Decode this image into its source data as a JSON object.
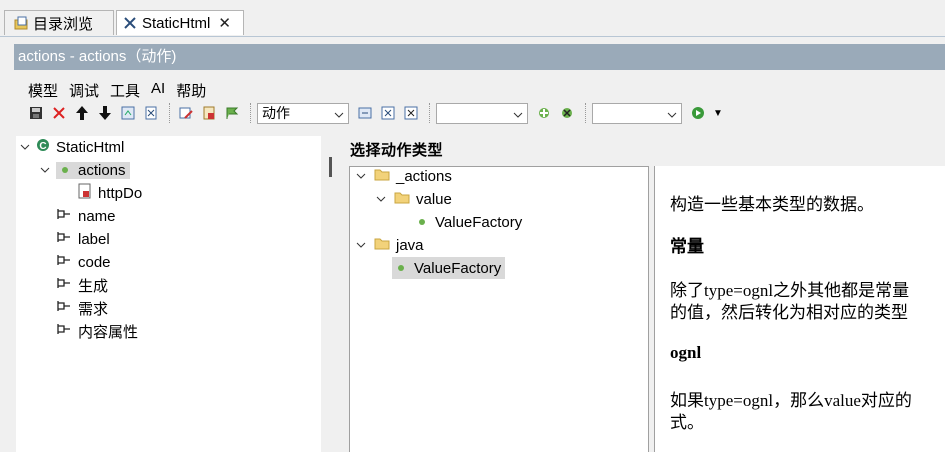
{
  "tabs": [
    {
      "label": "目录浏览",
      "icon": "folder-page-icon",
      "active": false
    },
    {
      "label": "StaticHtml",
      "icon": "tool-icon",
      "active": true,
      "close": "✕"
    }
  ],
  "header": {
    "title": "actions - actions（动作)"
  },
  "menu": [
    "模型",
    "调试",
    "工具",
    "AI",
    "帮助"
  ],
  "toolbar": {
    "icons": [
      "save-icon",
      "delete-icon",
      "move-up-icon",
      "move-down-icon",
      "refresh-icon",
      "export-icon",
      "edit-icon",
      "script-icon",
      "flag-icon",
      "open-icon",
      "debug-icon",
      "close-icon",
      "add-icon",
      "remove-icon",
      "run-icon"
    ],
    "combo1": "动作",
    "combo2": "",
    "combo3": "",
    "run_dropdown": "▼"
  },
  "tree": {
    "root": "StaticHtml",
    "actions": "actions",
    "httpDo": "httpDo",
    "attrs": [
      "name",
      "label",
      "code",
      "生成",
      "需求",
      "内容属性"
    ]
  },
  "middle": {
    "heading": "选择动作类型",
    "items": [
      "_actions",
      "value",
      "ValueFactory",
      "java",
      "ValueFactory"
    ]
  },
  "description": {
    "p1": "构造一些基本类型的数据。",
    "h1": "常量",
    "p2a": "除了type=ognl之外其他都是常量",
    "p2b": "的值，然后转化为相对应的类型",
    "h2": "ognl",
    "p3a": "如果type=ognl，那么value对应的",
    "p3b": "式。"
  },
  "colors": {
    "titlebar": "#9aaab9",
    "selection": "#d9d9d9",
    "dot_green": "#6ab04c",
    "folder": "#e8c65a"
  }
}
